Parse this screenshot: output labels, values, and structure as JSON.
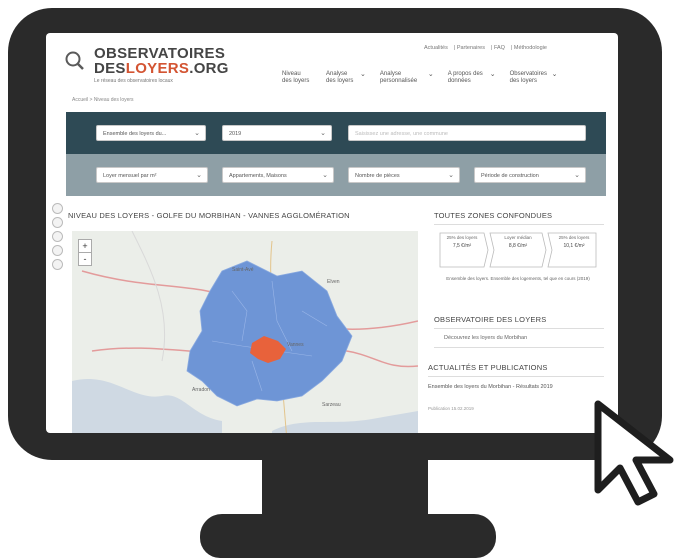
{
  "site": {
    "logo_line1": "OBSERVATOIRES",
    "logo_line2_a": "DES",
    "logo_line2_b": "LOYERS",
    "logo_line2_c": ".ORG",
    "tagline": "Le réseau des observatoires locaux",
    "accent": "#d35432"
  },
  "toplinks": [
    "Actualités",
    "Partenaires",
    "FAQ",
    "Méthodologie"
  ],
  "nav": [
    {
      "label": "Niveau des loyers",
      "has_caret": false
    },
    {
      "label": "Analyse des loyers",
      "has_caret": true
    },
    {
      "label": "Analyse personnalisée",
      "has_caret": true
    },
    {
      "label": "A propos des données",
      "has_caret": true
    },
    {
      "label": "Observatoires des loyers",
      "has_caret": true
    }
  ],
  "breadcrumb": "Accueil > Niveau des loyers",
  "filters": {
    "bar1": {
      "color": "#2e4a55",
      "select1": "Ensemble des loyers du...",
      "select2": "2019",
      "search_placeholder": "Saisissez une adresse, une commune"
    },
    "bar2": {
      "color": "#8e9fa6",
      "select1": "Loyer mensuel par m²",
      "select2": "Appartements, Maisons",
      "select3": "Nombre de pièces",
      "select4": "Période de construction"
    }
  },
  "map_section": {
    "title": "NIVEAU DES LOYERS - GOLFE DU MORBIHAN - VANNES AGGLOMÉRATION",
    "zoom_in": "+",
    "zoom_out": "-",
    "town_labels": [
      "Saint-Avé",
      "Elven",
      "Vannes",
      "Sarzeau",
      "Arradon"
    ],
    "colors": {
      "zone": "#6e95d6",
      "center": "#e8623b",
      "roads": "#e39b9b",
      "water": "#cfd9e3"
    }
  },
  "stats_section": {
    "title": "TOUTES ZONES CONFONDUES",
    "stats": [
      {
        "label": "25% des loyers",
        "value": "7,5 €/m²"
      },
      {
        "label": "Loyer médian",
        "value": "8,8 €/m²"
      },
      {
        "label": "25% des loyers",
        "value": "10,1 €/m²"
      }
    ],
    "note": "Ensemble des loyers. Ensemble des logements, tel que en cours (2019)"
  },
  "observatory": {
    "title": "OBSERVATOIRE DES LOYERS",
    "subtitle": "Découvrez les loyers du Morbihan"
  },
  "news": {
    "title": "ACTUALITÉS ET PUBLICATIONS",
    "item": "Ensemble des loyers du Morbihan - Résultats 2019",
    "date": "Publication 15.02.2019"
  }
}
